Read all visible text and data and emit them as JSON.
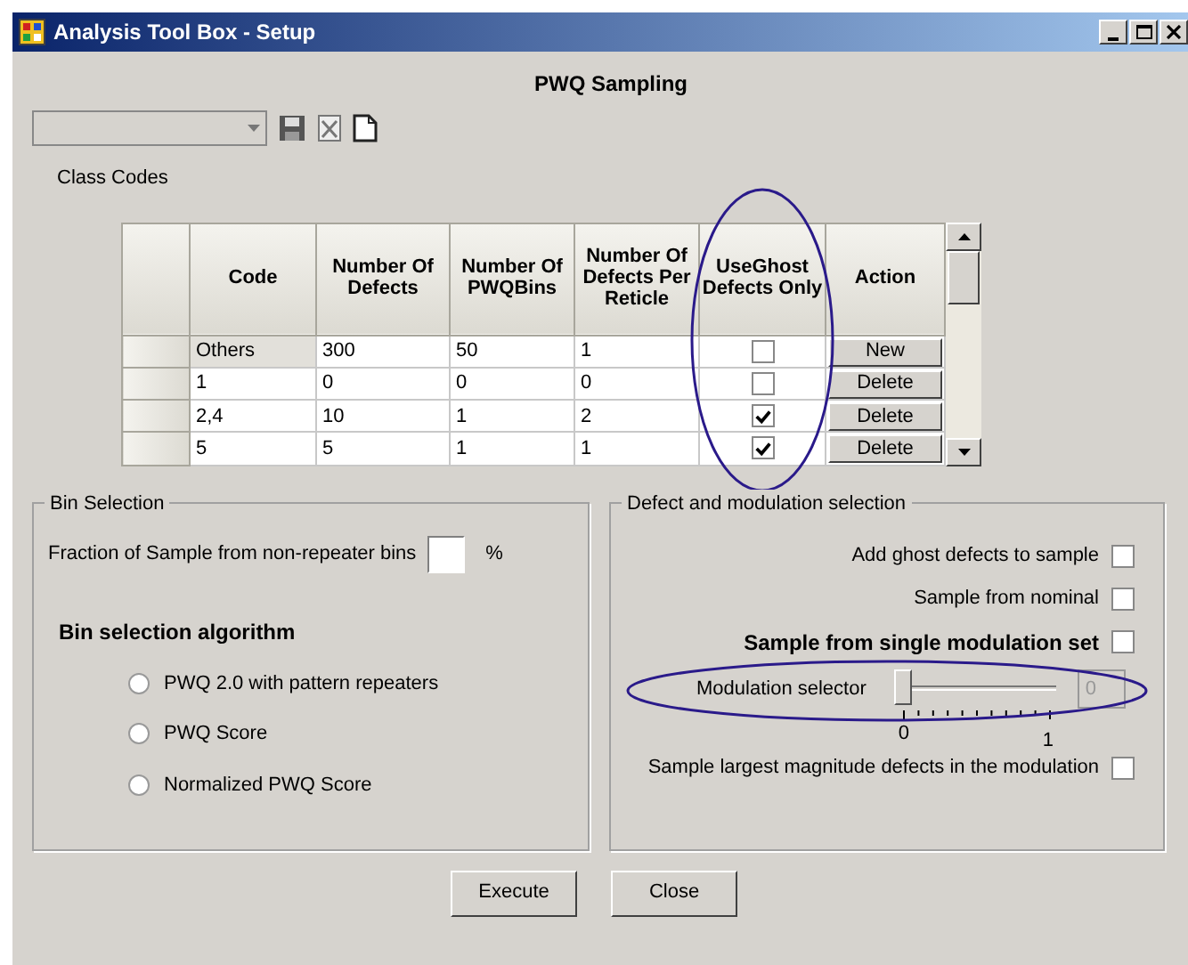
{
  "window": {
    "title": "Analysis Tool Box - Setup"
  },
  "heading": "PWQ Sampling",
  "class_codes": {
    "label": "Class Codes",
    "columns": [
      {
        "label": "Code",
        "highlighted": false
      },
      {
        "label": "Number Of Defects",
        "highlighted": false
      },
      {
        "label": "Number Of PWQBins",
        "highlighted": false
      },
      {
        "label": "Number Of Defects Per Reticle",
        "highlighted": false
      },
      {
        "label": "UseGhost Defects Only",
        "highlighted": true
      },
      {
        "label": "Action",
        "highlighted": false
      }
    ],
    "rows": [
      {
        "code": "Others",
        "defects": "300",
        "bins": "50",
        "per_reticle": "1",
        "ghost_only": false,
        "action": "New"
      },
      {
        "code": "1",
        "defects": "0",
        "bins": "0",
        "per_reticle": "0",
        "ghost_only": false,
        "action": "Delete"
      },
      {
        "code": "2,4",
        "defects": "10",
        "bins": "1",
        "per_reticle": "2",
        "ghost_only": true,
        "action": "Delete"
      },
      {
        "code": "5",
        "defects": "5",
        "bins": "1",
        "per_reticle": "1",
        "ghost_only": true,
        "action": "Delete"
      }
    ]
  },
  "bin_selection": {
    "title": "Bin Selection",
    "fraction_label": "Fraction of Sample from non-repeater bins",
    "fraction_unit": "%",
    "algorithm_title": "Bin selection algorithm",
    "algorithms": [
      {
        "label": "PWQ 2.0 with pattern repeaters",
        "selected": false
      },
      {
        "label": "PWQ Score",
        "selected": false
      },
      {
        "label": "Normalized PWQ Score",
        "selected": false
      }
    ]
  },
  "defect_selection": {
    "title": "Defect and modulation selection",
    "options": [
      {
        "label": "Add ghost defects to sample",
        "checked": false,
        "emphasized": false
      },
      {
        "label": "Sample from nominal",
        "checked": false,
        "emphasized": false
      },
      {
        "label": "Sample from single modulation set",
        "checked": false,
        "emphasized": true
      }
    ],
    "modulation_selector": {
      "label": "Modulation selector",
      "level": 0,
      "value": "0",
      "min_label": "0",
      "max_label": "1",
      "highlighted": true
    },
    "largest_option": {
      "label": "Sample largest magnitude defects in the modulation",
      "checked": false
    }
  },
  "buttons": [
    "Execute",
    "Close"
  ]
}
